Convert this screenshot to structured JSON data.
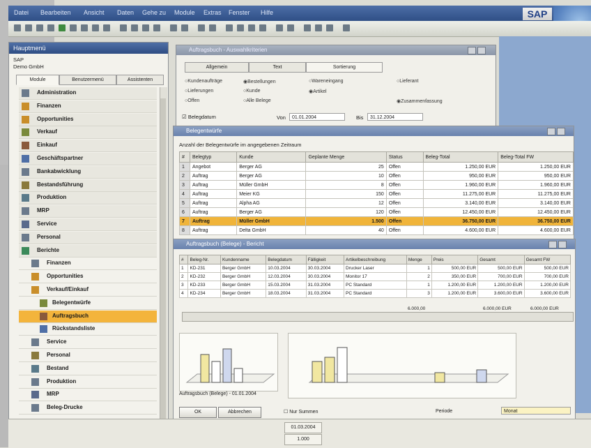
{
  "app": {
    "logo_text": "SAP"
  },
  "menubar": {
    "items": [
      "Datei",
      "Bearbeiten",
      "Ansicht",
      "Daten",
      "Gehe zu",
      "Module",
      "Extras",
      "Fenster",
      "Hilfe"
    ]
  },
  "main_menu": {
    "title": "Hauptmenü",
    "user_line1": "SAP",
    "user_line2": "Demo GmbH",
    "tabs": [
      "Module",
      "Benutzermenü",
      "Assistenten"
    ],
    "items": [
      {
        "label": "Administration",
        "icon": "gear-icon",
        "kind": "group"
      },
      {
        "label": "Finanzen",
        "icon": "coins-icon",
        "kind": "group"
      },
      {
        "label": "Opportunities",
        "icon": "target-icon",
        "kind": "group"
      },
      {
        "label": "Verkauf",
        "icon": "cart-icon",
        "kind": "group"
      },
      {
        "label": "Einkauf",
        "icon": "truck-icon",
        "kind": "group"
      },
      {
        "label": "Geschäftspartner",
        "icon": "people-icon",
        "kind": "group"
      },
      {
        "label": "Bankabwicklung",
        "icon": "bank-icon",
        "kind": "group"
      },
      {
        "label": "Bestandsführung",
        "icon": "box-icon",
        "kind": "group"
      },
      {
        "label": "Produktion",
        "icon": "factory-icon",
        "kind": "group"
      },
      {
        "label": "MRP",
        "icon": "chart-icon",
        "kind": "group"
      },
      {
        "label": "Service",
        "icon": "wrench-icon",
        "kind": "group"
      },
      {
        "label": "Personal",
        "icon": "person-icon",
        "kind": "group"
      },
      {
        "label": "Berichte",
        "icon": "report-icon",
        "kind": "group"
      },
      {
        "label": "Finanzen",
        "icon": "folder-icon",
        "kind": "sub"
      },
      {
        "label": "Opportunities",
        "icon": "folder-icon",
        "kind": "sub"
      },
      {
        "label": "Verkauf/Einkauf",
        "icon": "folder-icon",
        "kind": "sub"
      },
      {
        "label": "Belegentwürfe",
        "icon": "doc-icon",
        "kind": "subsub"
      },
      {
        "label": "Auftragsbuch",
        "icon": "doc-icon",
        "kind": "subsub-sel"
      },
      {
        "label": "Rückstandsliste",
        "icon": "doc-icon",
        "kind": "subsub"
      },
      {
        "label": "Service",
        "icon": "folder-icon",
        "kind": "sub"
      },
      {
        "label": "Personal",
        "icon": "folder-icon",
        "kind": "sub"
      },
      {
        "label": "Bestand",
        "icon": "folder-icon",
        "kind": "sub"
      },
      {
        "label": "Produktion",
        "icon": "folder-icon",
        "kind": "sub"
      },
      {
        "label": "MRP",
        "icon": "folder-icon",
        "kind": "sub"
      },
      {
        "label": "Beleg-Drucke",
        "icon": "folder-icon",
        "kind": "sub"
      }
    ]
  },
  "form_window": {
    "title": "Auftragsbuch - Auswahlkriterien",
    "tabs": [
      "Allgemein",
      "Text",
      "Sortierung"
    ],
    "radios": [
      {
        "label": "Kundenaufträge",
        "on": true
      },
      {
        "label": "Lieferungen",
        "on": false
      },
      {
        "label": "Offen",
        "on": false
      },
      {
        "label": "Bestellungen",
        "on": true
      },
      {
        "label": "Kunde",
        "on": false
      },
      {
        "label": "Alle Belege",
        "on": false
      },
      {
        "label": "Wareneingang",
        "on": false
      },
      {
        "label": "Artikel",
        "on": true
      },
      {
        "label": "Lieferant",
        "on": false
      },
      {
        "label": "Zusammenfassung",
        "on": true
      }
    ],
    "date_label": "Belegdatum",
    "from_label": "Von",
    "from_value": "01.01.2004",
    "to_label": "Bis",
    "to_value": "31.12.2004"
  },
  "drafts_window": {
    "title": "Belegentwürfe",
    "subtitle": "Anzahl der Belegentwürfe im angegebenen Zeitraum",
    "columns": [
      "#",
      "Belegtyp",
      "Kunde",
      "Geplante Menge",
      "Status",
      "Beleg-Total",
      "Beleg-Total FW"
    ],
    "rows": [
      [
        "1",
        "Angebot",
        "Berger AG",
        "25",
        "Offen",
        "1.250,00 EUR",
        "1.250,00 EUR"
      ],
      [
        "2",
        "Auftrag",
        "Berger AG",
        "10",
        "Offen",
        "950,00 EUR",
        "950,00 EUR"
      ],
      [
        "3",
        "Auftrag",
        "Müller GmbH",
        "8",
        "Offen",
        "1.960,00 EUR",
        "1.960,00 EUR"
      ],
      [
        "4",
        "Auftrag",
        "Meier KG",
        "150",
        "Offen",
        "11.275,00 EUR",
        "11.275,00 EUR"
      ],
      [
        "5",
        "Auftrag",
        "Alpha AG",
        "12",
        "Offen",
        "3.140,00 EUR",
        "3.140,00 EUR"
      ],
      [
        "6",
        "Auftrag",
        "Berger AG",
        "120",
        "Offen",
        "12.450,00 EUR",
        "12.450,00 EUR"
      ],
      [
        "7",
        "Auftrag",
        "Müller GmbH",
        "1.500",
        "Offen",
        "36.750,00 EUR",
        "36.750,00 EUR"
      ],
      [
        "8",
        "Auftrag",
        "Delta GmbH",
        "40",
        "Offen",
        "4.600,00 EUR",
        "4.600,00 EUR"
      ]
    ],
    "selected_row": 6
  },
  "report_window": {
    "title": "Auftragsbuch (Belege) - Bericht",
    "columns": [
      "#",
      "Beleg-Nr.",
      "Kundenname",
      "Belegdatum",
      "Fälligkeit",
      "Artikelbeschreibung",
      "Menge",
      "Preis",
      "Gesamt",
      "Gesamt FW"
    ],
    "rows": [
      [
        "1",
        "KD-231",
        "Berger GmbH",
        "10.03.2004",
        "30.03.2004",
        "Drucker Laser",
        "1",
        "500,00 EUR",
        "500,00 EUR",
        "500,00 EUR"
      ],
      [
        "2",
        "KD-232",
        "Berger GmbH",
        "12.03.2004",
        "30.03.2004",
        "Monitor 17",
        "2",
        "350,00 EUR",
        "700,00 EUR",
        "700,00 EUR"
      ],
      [
        "3",
        "KD-233",
        "Berger GmbH",
        "15.03.2004",
        "31.03.2004",
        "PC Standard",
        "1",
        "1.200,00 EUR",
        "1.200,00 EUR",
        "1.200,00 EUR"
      ],
      [
        "4",
        "KD-234",
        "Berger GmbH",
        "18.03.2004",
        "31.03.2004",
        "PC Standard",
        "3",
        "1.200,00 EUR",
        "3.600,00 EUR",
        "3.600,00 EUR"
      ]
    ],
    "totals": [
      "6.000,00",
      "6.000,00 EUR",
      "6.000,00 EUR"
    ],
    "chart_caption": "Auftragsbuch (Belege) - 01.01.2004",
    "ok_label": "OK",
    "cancel_label": "Abbrechen",
    "checkbox_label": "Nur Summen",
    "period_label": "Periode",
    "period_value": "Monat"
  },
  "status": {
    "value1": "01.03.2004",
    "value2": "1.000"
  }
}
